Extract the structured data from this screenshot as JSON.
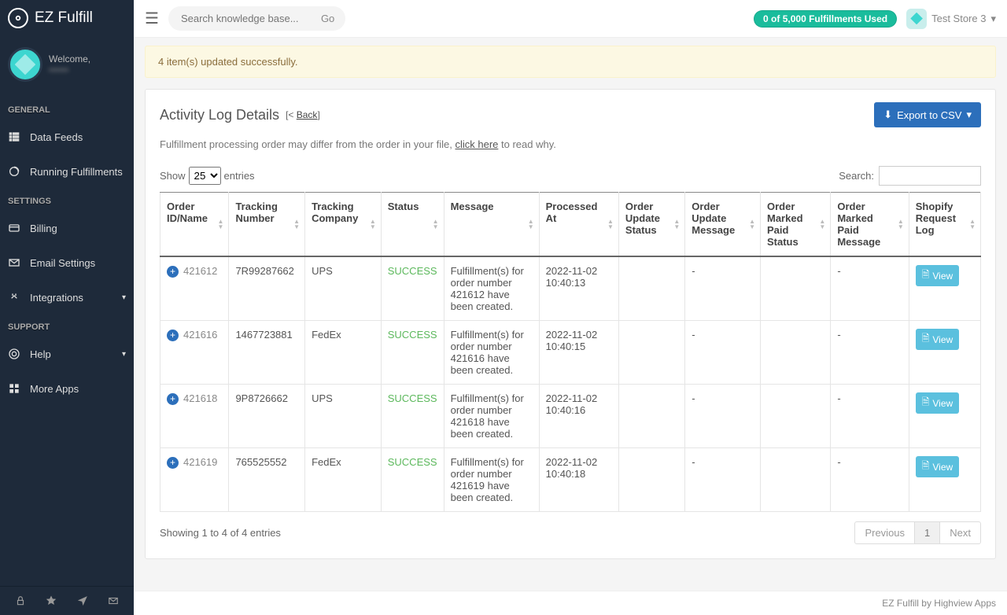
{
  "brand": {
    "name": "EZ Fulfill"
  },
  "user": {
    "welcome": "Welcome,",
    "name": "••••••"
  },
  "nav": {
    "general_heading": "GENERAL",
    "settings_heading": "SETTINGS",
    "support_heading": "SUPPORT",
    "data_feeds": "Data Feeds",
    "running_fulfillments": "Running Fulfillments",
    "billing": "Billing",
    "email_settings": "Email Settings",
    "integrations": "Integrations",
    "help": "Help",
    "more_apps": "More Apps"
  },
  "topbar": {
    "search_placeholder": "Search knowledge base...",
    "go": "Go",
    "usage_badge": "0 of 5,000 Fulfillments Used",
    "store_name": "Test Store 3"
  },
  "alert": {
    "text": "4 item(s) updated successfully."
  },
  "page": {
    "title": "Activity Log Details",
    "back_prefix": "[< ",
    "back_text": "Back",
    "back_suffix": "]",
    "export": "Export to CSV",
    "note_pre": "Fulfillment processing order may differ from the order in your file, ",
    "note_link": "click here",
    "note_post": " to read why."
  },
  "table": {
    "show": "Show",
    "entries": "entries",
    "page_size": "25",
    "search_label": "Search:",
    "headers": {
      "order": "Order ID/Name",
      "tracking_no": "Tracking Number",
      "tracking_co": "Tracking Company",
      "status": "Status",
      "message": "Message",
      "processed_at": "Processed At",
      "ou_status": "Order Update Status",
      "ou_message": "Order Update Message",
      "omp_status": "Order Marked Paid Status",
      "omp_message": "Order Marked Paid Message",
      "req_log": "Shopify Request Log"
    },
    "view_label": "View",
    "rows": [
      {
        "order": "421612",
        "tracking_no": "7R99287662",
        "tracking_co": "UPS",
        "status": "SUCCESS",
        "message": "Fulfillment(s) for order number 421612 have been created.",
        "processed_at": "2022-11-02 10:40:13",
        "ou_status": "",
        "ou_message": "-",
        "omp_status": "",
        "omp_message": "-"
      },
      {
        "order": "421616",
        "tracking_no": "1467723881",
        "tracking_co": "FedEx",
        "status": "SUCCESS",
        "message": "Fulfillment(s) for order number 421616 have been created.",
        "processed_at": "2022-11-02 10:40:15",
        "ou_status": "",
        "ou_message": "-",
        "omp_status": "",
        "omp_message": "-"
      },
      {
        "order": "421618",
        "tracking_no": "9P8726662",
        "tracking_co": "UPS",
        "status": "SUCCESS",
        "message": "Fulfillment(s) for order number 421618 have been created.",
        "processed_at": "2022-11-02 10:40:16",
        "ou_status": "",
        "ou_message": "-",
        "omp_status": "",
        "omp_message": "-"
      },
      {
        "order": "421619",
        "tracking_no": "765525552",
        "tracking_co": "FedEx",
        "status": "SUCCESS",
        "message": "Fulfillment(s) for order number 421619 have been created.",
        "processed_at": "2022-11-02 10:40:18",
        "ou_status": "",
        "ou_message": "-",
        "omp_status": "",
        "omp_message": "-"
      }
    ],
    "info": "Showing 1 to 4 of 4 entries",
    "prev": "Previous",
    "page1": "1",
    "next": "Next"
  },
  "footer": {
    "text": "EZ Fulfill by Highview Apps"
  }
}
